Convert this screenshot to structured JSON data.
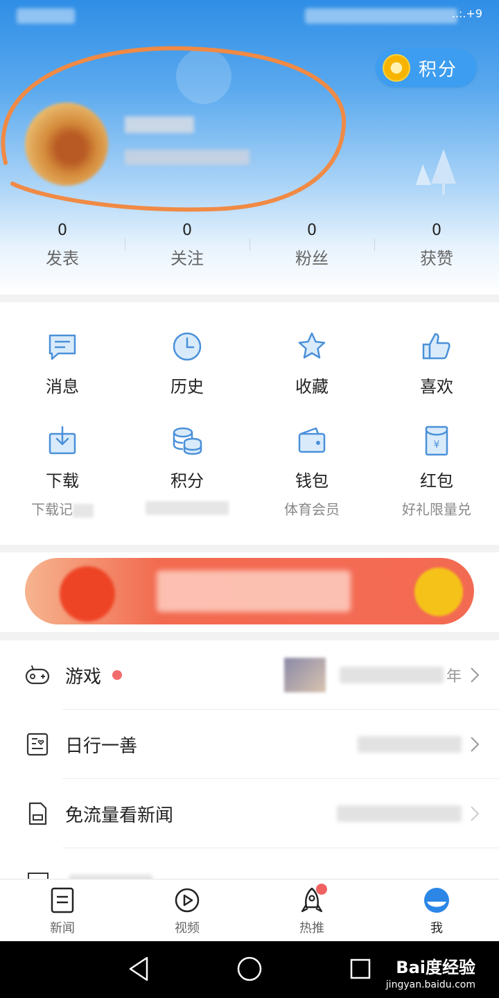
{
  "header": {
    "status_time": "..:.+9",
    "points_button_label": "积分",
    "stats": [
      {
        "value": "0",
        "label": "发表"
      },
      {
        "value": "0",
        "label": "关注"
      },
      {
        "value": "0",
        "label": "粉丝"
      },
      {
        "value": "0",
        "label": "获赞"
      }
    ]
  },
  "grid": {
    "row1": [
      {
        "label": "消息",
        "icon": "message-icon"
      },
      {
        "label": "历史",
        "icon": "history-clock-icon"
      },
      {
        "label": "收藏",
        "icon": "star-icon"
      },
      {
        "label": "喜欢",
        "icon": "thumbs-up-icon"
      }
    ],
    "row2": [
      {
        "label": "下载",
        "sub": "下载记",
        "icon": "download-icon"
      },
      {
        "label": "积分",
        "sub": "",
        "icon": "coins-icon"
      },
      {
        "label": "钱包",
        "sub": "体育会员",
        "icon": "wallet-icon"
      },
      {
        "label": "红包",
        "sub": "好礼限量兑",
        "icon": "red-envelope-icon"
      }
    ]
  },
  "list": [
    {
      "label": "游戏",
      "icon": "gamepad-icon",
      "right_text": "年",
      "has_dot": true
    },
    {
      "label": "日行一善",
      "icon": "charity-card-icon",
      "right_text": "",
      "has_dot": false
    },
    {
      "label": "免流量看新闻",
      "icon": "sim-card-icon",
      "right_text": "",
      "has_dot": false
    }
  ],
  "bottom_nav": [
    {
      "label": "新闻",
      "icon": "news-icon"
    },
    {
      "label": "视频",
      "icon": "video-play-icon"
    },
    {
      "label": "热推",
      "icon": "rocket-icon"
    },
    {
      "label": "我",
      "icon": "profile-icon"
    }
  ],
  "watermark": {
    "title": "Bai度经验",
    "url": "jingyan.baidu.com"
  },
  "colors": {
    "accent": "#3d9df0",
    "icon_blue": "#4a90d9",
    "badge_red": "#f06262",
    "annotation_orange": "#f08a45"
  }
}
